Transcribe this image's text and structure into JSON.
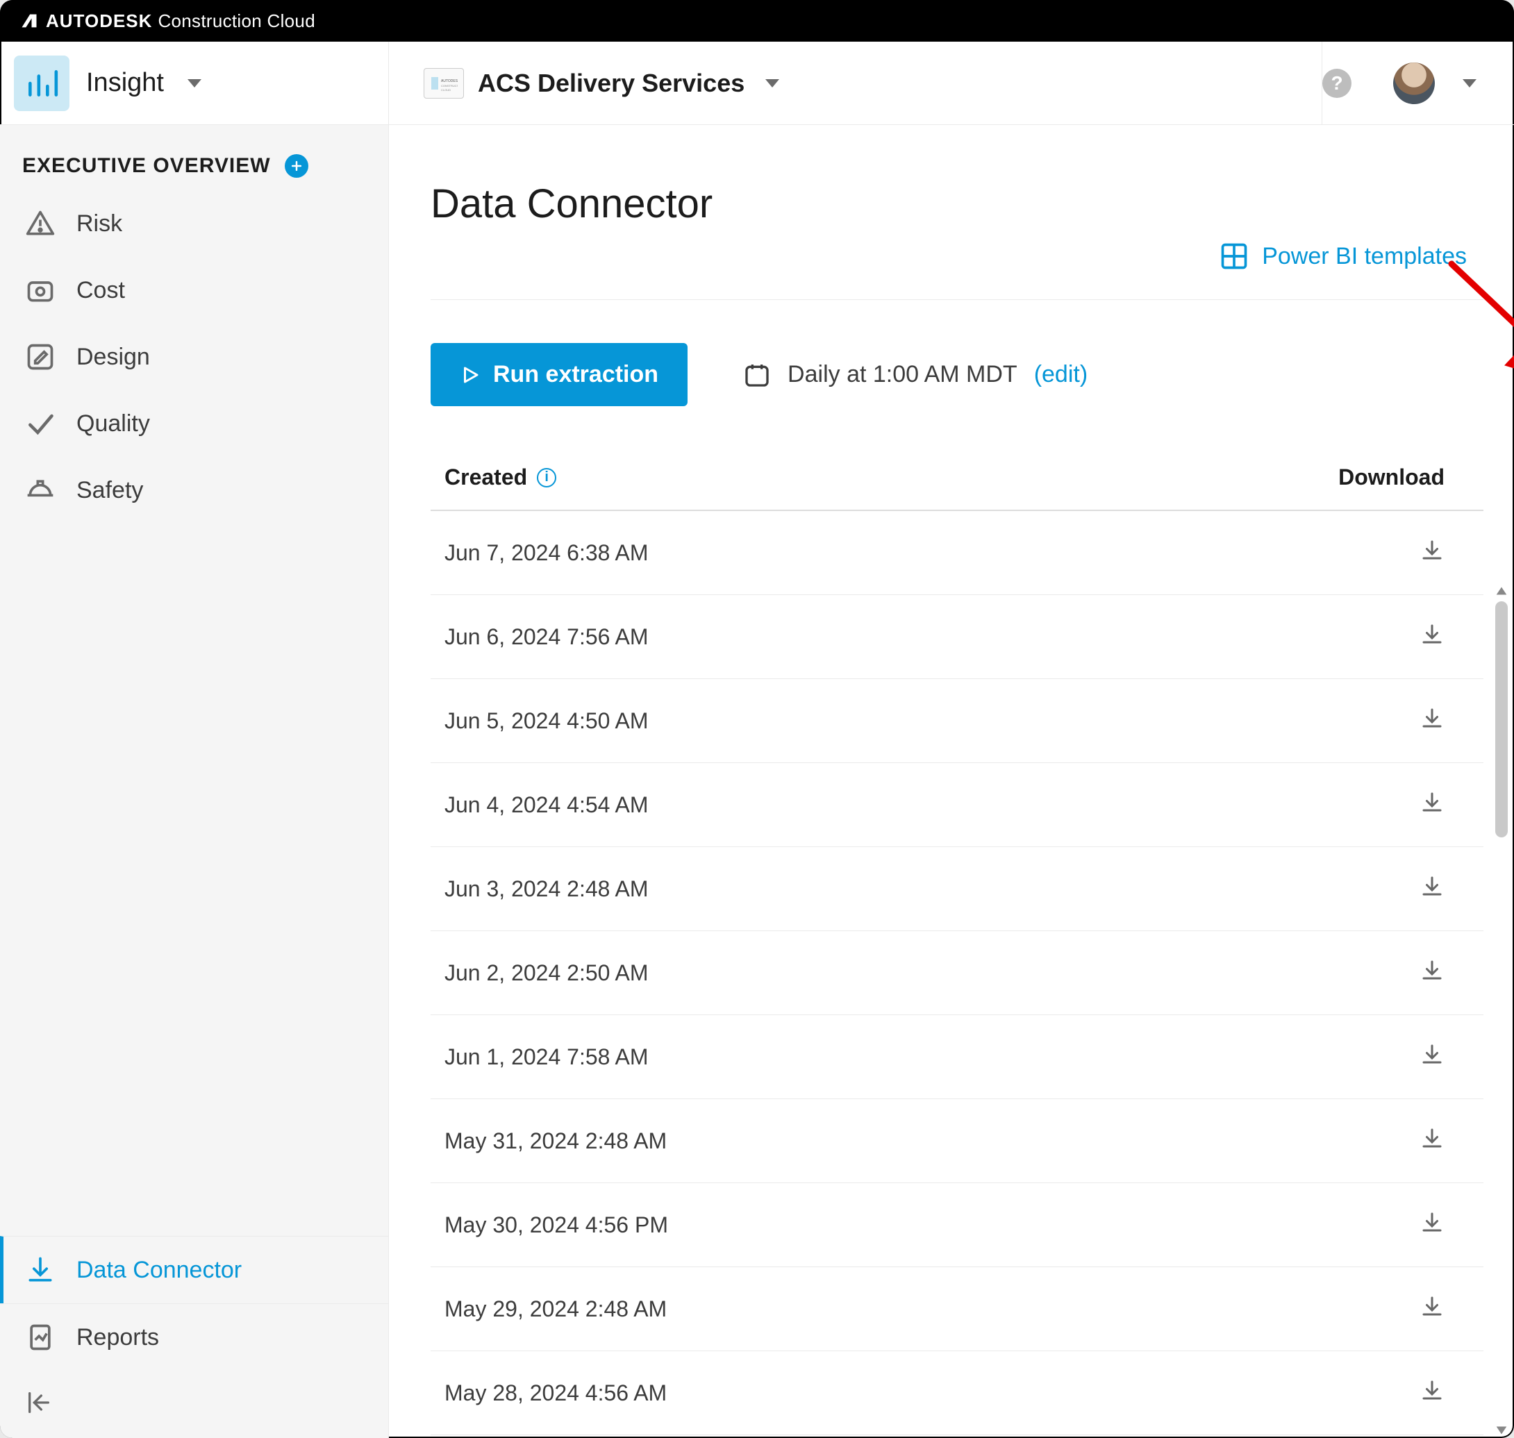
{
  "brand": {
    "bold": "AUTODESK",
    "light": "Construction Cloud"
  },
  "header": {
    "module": "Insight",
    "project": "ACS Delivery Services",
    "acc_badge_text": "AUTODESK CONSTRUCTION CLOUD"
  },
  "sidebar": {
    "title": "EXECUTIVE OVERVIEW",
    "items": [
      {
        "icon": "warning-triangle-icon",
        "label": "Risk"
      },
      {
        "icon": "price-tag-icon",
        "label": "Cost"
      },
      {
        "icon": "pencil-square-icon",
        "label": "Design"
      },
      {
        "icon": "check-icon",
        "label": "Quality"
      },
      {
        "icon": "hard-hat-icon",
        "label": "Safety"
      }
    ],
    "bottom": [
      {
        "icon": "download-icon",
        "label": "Data Connector",
        "active": true
      },
      {
        "icon": "report-icon",
        "label": "Reports",
        "active": false
      }
    ]
  },
  "page": {
    "title": "Data Connector",
    "pbi_link": "Power BI templates",
    "run_btn": "Run extraction",
    "schedule_text": "Daily at 1:00 AM MDT",
    "schedule_edit": "(edit)"
  },
  "table": {
    "head_created": "Created",
    "head_download": "Download",
    "rows": [
      {
        "created": "Jun 7, 2024 6:38 AM"
      },
      {
        "created": "Jun 6, 2024 7:56 AM"
      },
      {
        "created": "Jun 5, 2024 4:50 AM"
      },
      {
        "created": "Jun 4, 2024 4:54 AM"
      },
      {
        "created": "Jun 3, 2024 2:48 AM"
      },
      {
        "created": "Jun 2, 2024 2:50 AM"
      },
      {
        "created": "Jun 1, 2024 7:58 AM"
      },
      {
        "created": "May 31, 2024 2:48 AM"
      },
      {
        "created": "May 30, 2024 4:56 PM"
      },
      {
        "created": "May 29, 2024 2:48 AM"
      },
      {
        "created": "May 28, 2024 4:56 AM"
      }
    ]
  },
  "colors": {
    "accent": "#0696d7"
  }
}
